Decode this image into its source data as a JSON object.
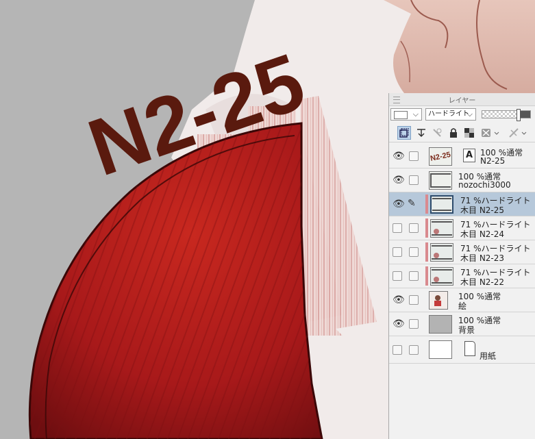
{
  "canvas": {
    "title_text": "N2-25",
    "title_color": "#5a1a0e",
    "shape_color": "#b01e1e"
  },
  "panel": {
    "title": "レイヤー",
    "blend_mode": "ハードライト",
    "icons": [
      "new-layer-icon",
      "transfer-icon",
      "lock-transparent-icon",
      "lock-icon",
      "checker-icon",
      "mask-icon",
      "clip-icon"
    ]
  },
  "layers": [
    {
      "line1": "100 %通常",
      "line2": "N2-25",
      "visible": true,
      "thumb": "text",
      "thumb_text": "N2-25",
      "badge": "A",
      "clipped": false,
      "selected": false
    },
    {
      "line1": "100 %通常",
      "line2": "nozochi3000",
      "visible": true,
      "thumb": "frame",
      "clipped": false,
      "selected": false
    },
    {
      "line1": "71 %ハードライト",
      "line2": "木目 N2-25",
      "visible": true,
      "thumb": "wood",
      "clipped": true,
      "selected": true
    },
    {
      "line1": "71 %ハードライト",
      "line2": "木目 N2-24",
      "visible": false,
      "thumb": "wood",
      "clipped": true,
      "selected": false
    },
    {
      "line1": "71 %ハードライト",
      "line2": "木目 N2-23",
      "visible": false,
      "thumb": "wood",
      "clipped": true,
      "selected": false
    },
    {
      "line1": "71 %ハードライト",
      "line2": "木目 N2-22",
      "visible": false,
      "thumb": "wood",
      "clipped": true,
      "selected": false
    },
    {
      "line1": "100 %通常",
      "line2": "絵",
      "visible": true,
      "thumb": "art",
      "clipped": false,
      "selected": false
    },
    {
      "line1": "100 %通常",
      "line2": "背景",
      "visible": true,
      "thumb": "gray",
      "clipped": false,
      "selected": false
    },
    {
      "line1": "用紙",
      "line2": "",
      "visible": false,
      "thumb": "paper",
      "clipped": false,
      "selected": false
    }
  ]
}
